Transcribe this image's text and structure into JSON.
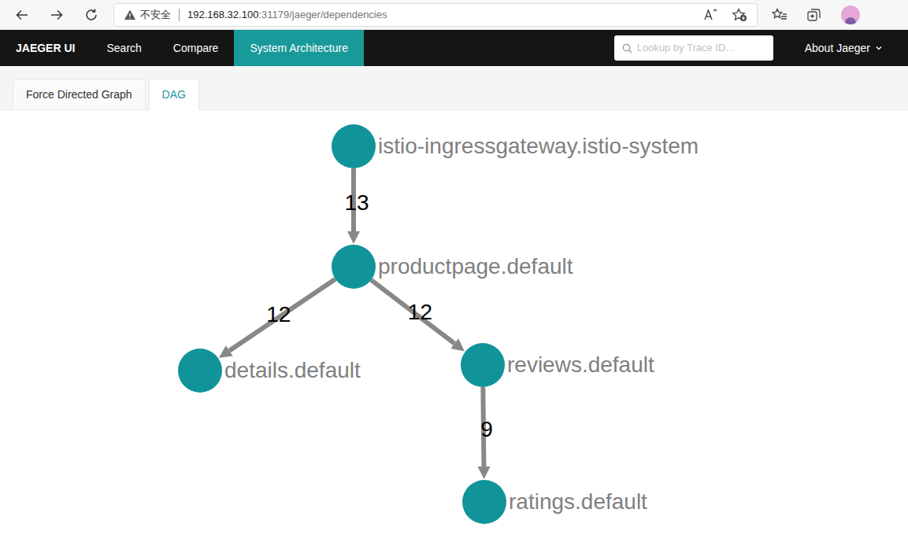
{
  "browser": {
    "security": "不安全",
    "url_host": "192.168.32.100",
    "url_path": ":31179/jaeger/dependencies"
  },
  "nav": {
    "brand": "JAEGER UI",
    "items": [
      {
        "label": "Search",
        "selected": false
      },
      {
        "label": "Compare",
        "selected": false
      },
      {
        "label": "System Architecture",
        "selected": true
      }
    ],
    "search": {
      "placeholder": "Lookup by Trace ID..."
    },
    "about": "About Jaeger"
  },
  "tabs": [
    {
      "label": "Force Directed Graph",
      "selected": false
    },
    {
      "label": "DAG",
      "selected": true
    }
  ],
  "dag": {
    "nodes": [
      {
        "name": "istio-ingressgateway.istio-system"
      },
      {
        "name": "productpage.default"
      },
      {
        "name": "details.default"
      },
      {
        "name": "reviews.default"
      },
      {
        "name": "ratings.default"
      }
    ],
    "edges": [
      {
        "from": 0,
        "to": 1,
        "count": "13"
      },
      {
        "from": 1,
        "to": 2,
        "count": "12"
      },
      {
        "from": 1,
        "to": 3,
        "count": "12"
      },
      {
        "from": 3,
        "to": 4,
        "count": "9"
      }
    ]
  }
}
